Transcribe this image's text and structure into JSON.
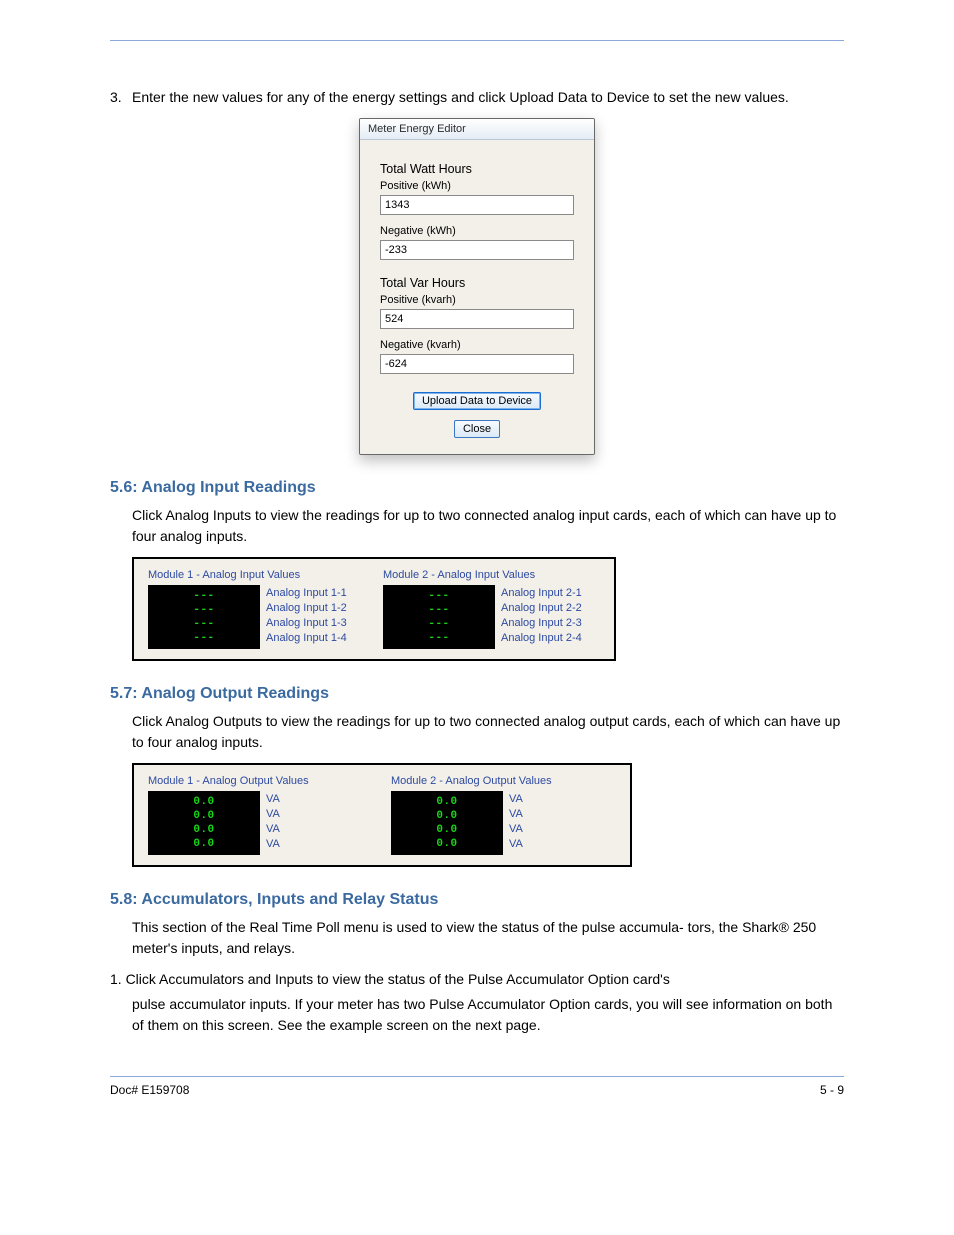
{
  "header": {
    "page_no_line1": "Enter the new values for any of the energy settings and click Upload Data to Device to set",
    "page_no_line2": "the new values."
  },
  "dialog": {
    "title": "Meter Energy Editor",
    "watt_label": "Total Watt Hours",
    "watt_pos_label": "Positive (kWh)",
    "watt_pos_value": "1343",
    "watt_neg_label": "Negative (kWh)",
    "watt_neg_value": "-233",
    "var_label": "Total Var Hours",
    "var_pos_label": "Positive (kvarh)",
    "var_pos_value": "524",
    "var_neg_label": "Negative (kvarh)",
    "var_neg_value": "-624",
    "upload_btn": "Upload Data to Device",
    "close_btn": "Close"
  },
  "section56": {
    "heading": "5.6: Analog Input Readings",
    "line1": "Click Analog Inputs to view the readings for up to two connected analog input cards, each",
    "line2": "of which can have up to four analog inputs."
  },
  "section57": {
    "heading": "5.7: Analog Output Readings",
    "line1": "Click Analog Outputs to view the readings for up to two connected analog output cards,",
    "line2": "each of which can have up to four analog inputs."
  },
  "inputs_panel": {
    "col1_title": "Module 1 - Analog Input Values",
    "col2_title": "Module 2 - Analog Input Values",
    "lcd_rows": [
      "---",
      "---",
      "---",
      "---"
    ],
    "col1_labels": [
      "Analog Input 1-1",
      "Analog Input 1-2",
      "Analog Input 1-3",
      "Analog Input 1-4"
    ],
    "col2_labels": [
      "Analog Input 2-1",
      "Analog Input 2-2",
      "Analog Input 2-3",
      "Analog Input 2-4"
    ]
  },
  "outputs_panel": {
    "col1_title": "Module 1 - Analog Output Values",
    "col2_title": "Module 2 - Analog Output Values",
    "lcd_rows": [
      "0.0",
      "0.0",
      "0.0",
      "0.0"
    ],
    "unit": "VA"
  },
  "section58": {
    "heading": "5.8: Accumulators, Inputs and Relay Status",
    "lead": "This section of the Real Time Poll menu is used to view the status of the pulse accumula-",
    "lead2": "tors, the Shark® 250 meter's inputs, and relays.",
    "step1": "1.  Click Accumulators and Inputs to view the status of the Pulse Accumulator Option card's",
    "step1b": "pulse accumulator inputs. If your meter has two Pulse Accumulator Option cards, you",
    "step1c": "will see information on both of them on this screen. See the example screen on the next",
    "step1d": "page."
  },
  "footer": {
    "left": "Doc# E159708",
    "right": "5 - 9"
  }
}
